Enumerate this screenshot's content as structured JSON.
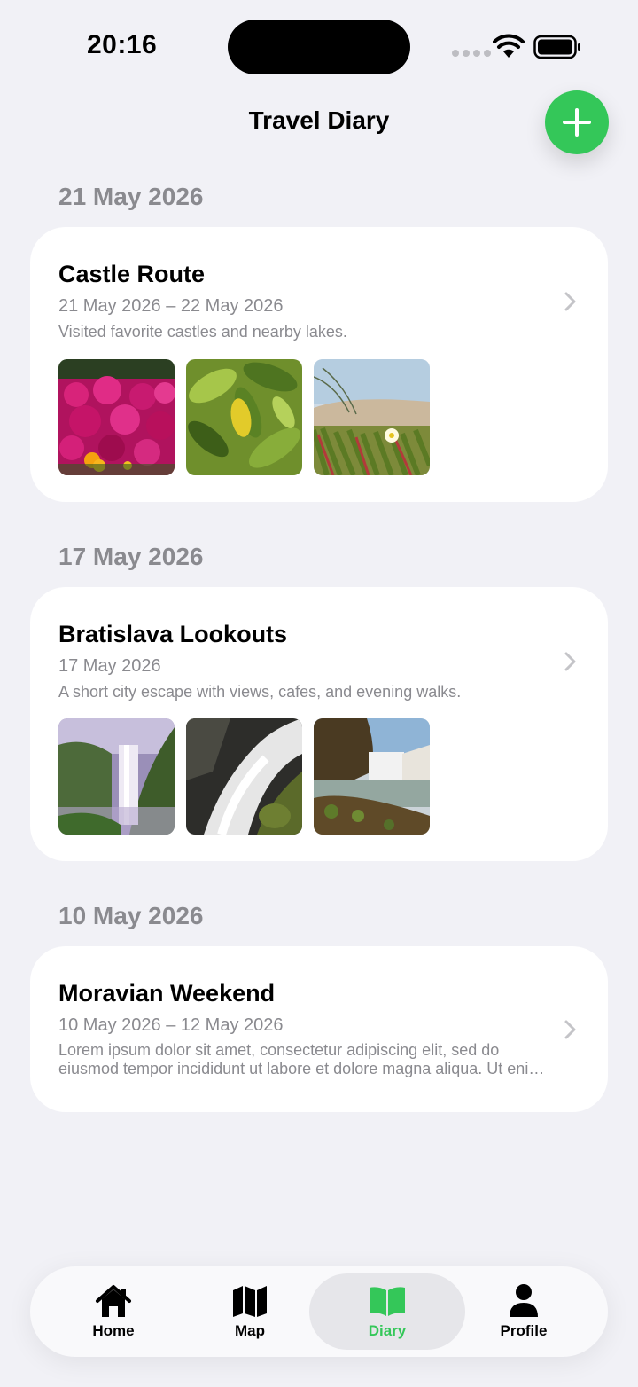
{
  "status_bar": {
    "time": "20:16"
  },
  "header": {
    "title": "Travel Diary"
  },
  "sections": [
    {
      "date_heading": "21 May 2026",
      "title": "Castle Route",
      "dates": "21 May 2026 – 22 May 2026",
      "description": "Visited favorite castles and nearby lakes.",
      "photos": [
        "flower-field-photo",
        "lemon-leaves-photo",
        "dune-flower-photo"
      ]
    },
    {
      "date_heading": "17 May 2026",
      "title": "Bratislava Lookouts",
      "dates": "17 May 2026",
      "description": "A short city escape with views, cafes, and evening walks.",
      "photos": [
        "misty-waterfall-photo",
        "cascade-rocks-photo",
        "cliff-waterfall-photo"
      ]
    },
    {
      "date_heading": "10 May 2026",
      "title": "Moravian Weekend",
      "dates": "10 May 2026 – 12 May 2026",
      "description": "Lorem ipsum dolor sit amet, consectetur adipiscing elit, sed do eiusmod tempor incididunt ut labore et dolore magna aliqua. Ut enim ad minim veniam.",
      "photos": []
    }
  ],
  "tab_bar": {
    "items": [
      {
        "label": "Home",
        "icon": "house-icon"
      },
      {
        "label": "Map",
        "icon": "map-icon"
      },
      {
        "label": "Diary",
        "icon": "book-icon",
        "active": true
      },
      {
        "label": "Profile",
        "icon": "person-icon"
      }
    ]
  },
  "colors": {
    "accent": "#34c759",
    "background": "#f1f1f6",
    "secondary_text": "#8a8a8f"
  }
}
